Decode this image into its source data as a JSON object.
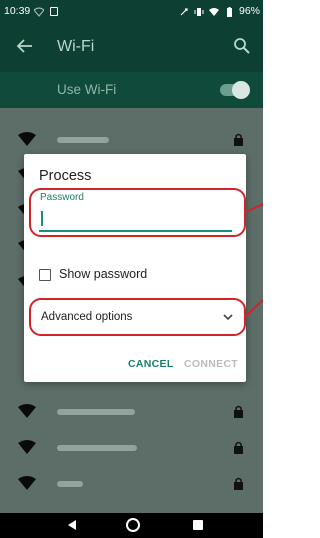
{
  "status": {
    "time": "10:39",
    "battery": "96%"
  },
  "appbar": {
    "title": "Wi-Fi"
  },
  "use_wifi": {
    "label": "Use Wi-Fi",
    "enabled": true
  },
  "networks": [
    {
      "secured": true
    },
    {
      "secured": true
    },
    {
      "secured": true
    },
    {
      "secured": true
    },
    {
      "secured": true
    },
    {
      "secured": true
    }
  ],
  "dialog": {
    "title": "Process",
    "password_label": "Password",
    "password_value": "",
    "show_password_label": "Show password",
    "show_password_checked": false,
    "advanced_options_label": "Advanced options",
    "cancel_label": "CANCEL",
    "connect_label": "CONNECT"
  },
  "colors": {
    "accent": "#1a8f77",
    "highlight": "#d2232a",
    "appbar": "#0e3f33"
  }
}
